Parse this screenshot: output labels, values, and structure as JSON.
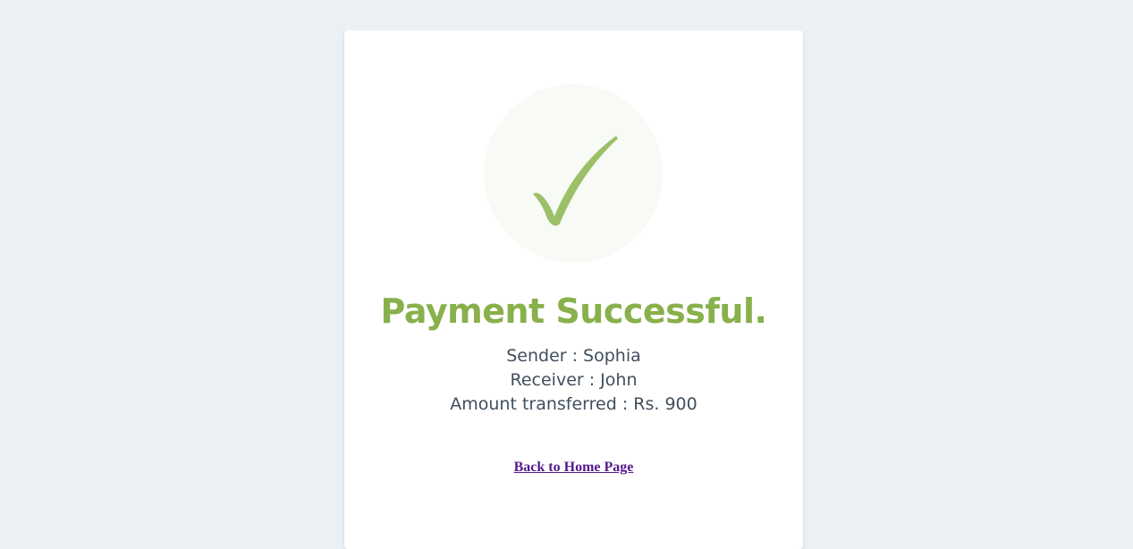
{
  "status": {
    "icon": "checkmark-icon",
    "title": "Payment Successful.",
    "accent_color": "#88B04B"
  },
  "details": {
    "sender": "Sender : Sophia",
    "receiver": "Receiver : John",
    "amount": "Amount transferred : Rs. 900"
  },
  "navigation": {
    "back_label": "Back to Home Page"
  }
}
